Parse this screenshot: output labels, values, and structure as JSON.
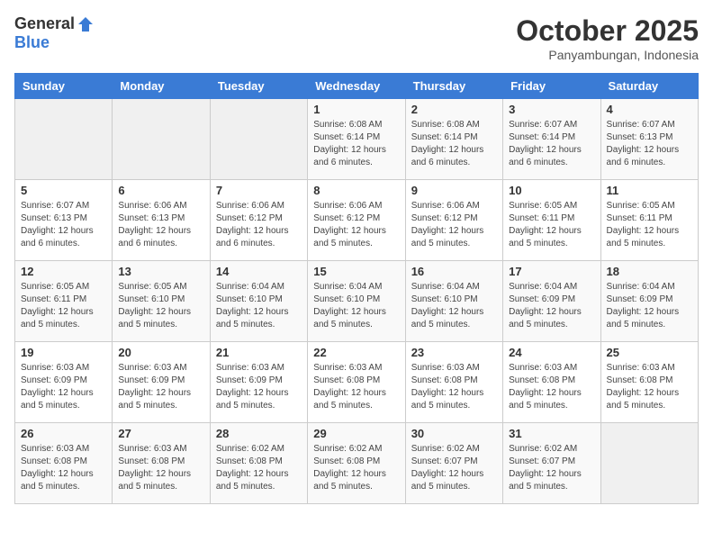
{
  "logo": {
    "general": "General",
    "blue": "Blue"
  },
  "header": {
    "title": "October 2025",
    "subtitle": "Panyambungan, Indonesia"
  },
  "weekdays": [
    "Sunday",
    "Monday",
    "Tuesday",
    "Wednesday",
    "Thursday",
    "Friday",
    "Saturday"
  ],
  "weeks": [
    [
      {
        "day": "",
        "empty": true
      },
      {
        "day": "",
        "empty": true
      },
      {
        "day": "",
        "empty": true
      },
      {
        "day": "1",
        "sunrise": "Sunrise: 6:08 AM",
        "sunset": "Sunset: 6:14 PM",
        "daylight": "Daylight: 12 hours and 6 minutes."
      },
      {
        "day": "2",
        "sunrise": "Sunrise: 6:08 AM",
        "sunset": "Sunset: 6:14 PM",
        "daylight": "Daylight: 12 hours and 6 minutes."
      },
      {
        "day": "3",
        "sunrise": "Sunrise: 6:07 AM",
        "sunset": "Sunset: 6:14 PM",
        "daylight": "Daylight: 12 hours and 6 minutes."
      },
      {
        "day": "4",
        "sunrise": "Sunrise: 6:07 AM",
        "sunset": "Sunset: 6:13 PM",
        "daylight": "Daylight: 12 hours and 6 minutes."
      }
    ],
    [
      {
        "day": "5",
        "sunrise": "Sunrise: 6:07 AM",
        "sunset": "Sunset: 6:13 PM",
        "daylight": "Daylight: 12 hours and 6 minutes."
      },
      {
        "day": "6",
        "sunrise": "Sunrise: 6:06 AM",
        "sunset": "Sunset: 6:13 PM",
        "daylight": "Daylight: 12 hours and 6 minutes."
      },
      {
        "day": "7",
        "sunrise": "Sunrise: 6:06 AM",
        "sunset": "Sunset: 6:12 PM",
        "daylight": "Daylight: 12 hours and 6 minutes."
      },
      {
        "day": "8",
        "sunrise": "Sunrise: 6:06 AM",
        "sunset": "Sunset: 6:12 PM",
        "daylight": "Daylight: 12 hours and 5 minutes."
      },
      {
        "day": "9",
        "sunrise": "Sunrise: 6:06 AM",
        "sunset": "Sunset: 6:12 PM",
        "daylight": "Daylight: 12 hours and 5 minutes."
      },
      {
        "day": "10",
        "sunrise": "Sunrise: 6:05 AM",
        "sunset": "Sunset: 6:11 PM",
        "daylight": "Daylight: 12 hours and 5 minutes."
      },
      {
        "day": "11",
        "sunrise": "Sunrise: 6:05 AM",
        "sunset": "Sunset: 6:11 PM",
        "daylight": "Daylight: 12 hours and 5 minutes."
      }
    ],
    [
      {
        "day": "12",
        "sunrise": "Sunrise: 6:05 AM",
        "sunset": "Sunset: 6:11 PM",
        "daylight": "Daylight: 12 hours and 5 minutes."
      },
      {
        "day": "13",
        "sunrise": "Sunrise: 6:05 AM",
        "sunset": "Sunset: 6:10 PM",
        "daylight": "Daylight: 12 hours and 5 minutes."
      },
      {
        "day": "14",
        "sunrise": "Sunrise: 6:04 AM",
        "sunset": "Sunset: 6:10 PM",
        "daylight": "Daylight: 12 hours and 5 minutes."
      },
      {
        "day": "15",
        "sunrise": "Sunrise: 6:04 AM",
        "sunset": "Sunset: 6:10 PM",
        "daylight": "Daylight: 12 hours and 5 minutes."
      },
      {
        "day": "16",
        "sunrise": "Sunrise: 6:04 AM",
        "sunset": "Sunset: 6:10 PM",
        "daylight": "Daylight: 12 hours and 5 minutes."
      },
      {
        "day": "17",
        "sunrise": "Sunrise: 6:04 AM",
        "sunset": "Sunset: 6:09 PM",
        "daylight": "Daylight: 12 hours and 5 minutes."
      },
      {
        "day": "18",
        "sunrise": "Sunrise: 6:04 AM",
        "sunset": "Sunset: 6:09 PM",
        "daylight": "Daylight: 12 hours and 5 minutes."
      }
    ],
    [
      {
        "day": "19",
        "sunrise": "Sunrise: 6:03 AM",
        "sunset": "Sunset: 6:09 PM",
        "daylight": "Daylight: 12 hours and 5 minutes."
      },
      {
        "day": "20",
        "sunrise": "Sunrise: 6:03 AM",
        "sunset": "Sunset: 6:09 PM",
        "daylight": "Daylight: 12 hours and 5 minutes."
      },
      {
        "day": "21",
        "sunrise": "Sunrise: 6:03 AM",
        "sunset": "Sunset: 6:09 PM",
        "daylight": "Daylight: 12 hours and 5 minutes."
      },
      {
        "day": "22",
        "sunrise": "Sunrise: 6:03 AM",
        "sunset": "Sunset: 6:08 PM",
        "daylight": "Daylight: 12 hours and 5 minutes."
      },
      {
        "day": "23",
        "sunrise": "Sunrise: 6:03 AM",
        "sunset": "Sunset: 6:08 PM",
        "daylight": "Daylight: 12 hours and 5 minutes."
      },
      {
        "day": "24",
        "sunrise": "Sunrise: 6:03 AM",
        "sunset": "Sunset: 6:08 PM",
        "daylight": "Daylight: 12 hours and 5 minutes."
      },
      {
        "day": "25",
        "sunrise": "Sunrise: 6:03 AM",
        "sunset": "Sunset: 6:08 PM",
        "daylight": "Daylight: 12 hours and 5 minutes."
      }
    ],
    [
      {
        "day": "26",
        "sunrise": "Sunrise: 6:03 AM",
        "sunset": "Sunset: 6:08 PM",
        "daylight": "Daylight: 12 hours and 5 minutes."
      },
      {
        "day": "27",
        "sunrise": "Sunrise: 6:03 AM",
        "sunset": "Sunset: 6:08 PM",
        "daylight": "Daylight: 12 hours and 5 minutes."
      },
      {
        "day": "28",
        "sunrise": "Sunrise: 6:02 AM",
        "sunset": "Sunset: 6:08 PM",
        "daylight": "Daylight: 12 hours and 5 minutes."
      },
      {
        "day": "29",
        "sunrise": "Sunrise: 6:02 AM",
        "sunset": "Sunset: 6:08 PM",
        "daylight": "Daylight: 12 hours and 5 minutes."
      },
      {
        "day": "30",
        "sunrise": "Sunrise: 6:02 AM",
        "sunset": "Sunset: 6:07 PM",
        "daylight": "Daylight: 12 hours and 5 minutes."
      },
      {
        "day": "31",
        "sunrise": "Sunrise: 6:02 AM",
        "sunset": "Sunset: 6:07 PM",
        "daylight": "Daylight: 12 hours and 5 minutes."
      },
      {
        "day": "",
        "empty": true
      }
    ]
  ]
}
